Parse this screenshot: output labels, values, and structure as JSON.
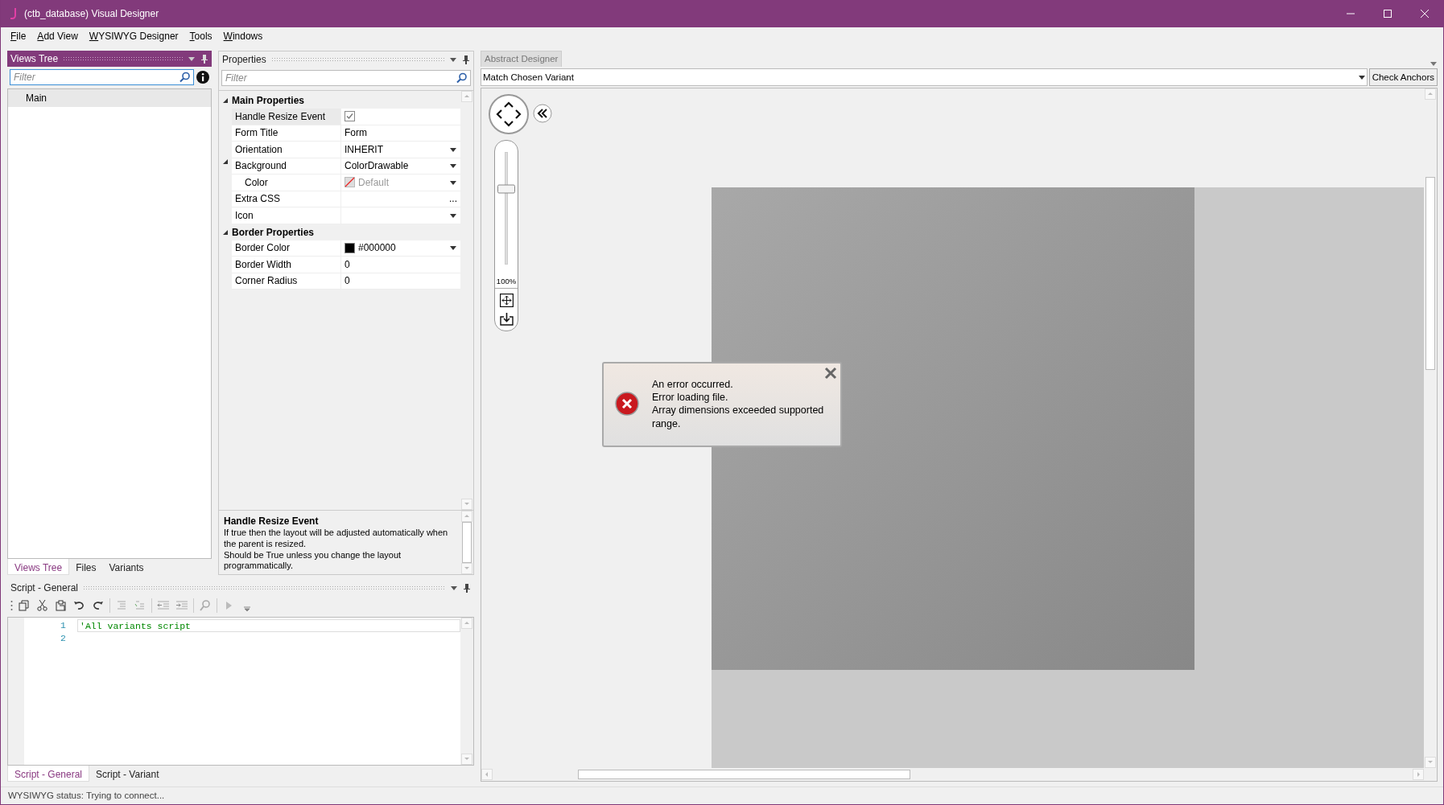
{
  "window": {
    "title": "(ctb_database) Visual Designer"
  },
  "menu": [
    {
      "label": "File"
    },
    {
      "label": "Add View"
    },
    {
      "label": "WYSIWYG Designer"
    },
    {
      "label": "Tools"
    },
    {
      "label": "Windows"
    }
  ],
  "views_tree": {
    "title": "Views Tree",
    "active": true,
    "filter": {
      "placeholder": "Filter"
    },
    "items": [
      {
        "label": "Main",
        "selected": true
      }
    ],
    "tabs": [
      {
        "label": "Views Tree",
        "selected": true
      },
      {
        "label": "Files",
        "selected": false
      },
      {
        "label": "Variants",
        "selected": false
      }
    ]
  },
  "properties": {
    "title": "Properties",
    "active": false,
    "filter": {
      "placeholder": "Filter"
    },
    "groups": [
      {
        "label": "Main Properties",
        "expanded": true,
        "rows": [
          {
            "name": "Handle Resize Event",
            "kind": "checkbox",
            "checked": true,
            "selected": true
          },
          {
            "name": "Form Title",
            "kind": "text",
            "value": "Form",
            "selected": false
          },
          {
            "name": "Orientation",
            "kind": "dropdown",
            "value": "INHERIT",
            "selected": false
          },
          {
            "name": "Background",
            "kind": "dropdown",
            "value": "ColorDrawable",
            "selected": false,
            "expanded": true,
            "children": [
              {
                "name": "Color",
                "kind": "color-none",
                "value": "Default",
                "selected": false
              }
            ]
          },
          {
            "name": "Extra CSS",
            "kind": "ellipsis",
            "value_button": "...",
            "selected": false
          },
          {
            "name": "Icon",
            "kind": "dropdown",
            "selected": false
          }
        ]
      },
      {
        "label": "Border Properties",
        "expanded": true,
        "rows": [
          {
            "name": "Border Color",
            "kind": "color",
            "value": "#000000",
            "selected": false
          },
          {
            "name": "Border Width",
            "kind": "text",
            "value": "0",
            "selected": false
          },
          {
            "name": "Corner Radius",
            "kind": "text",
            "value": "0",
            "selected": false
          }
        ]
      }
    ],
    "description": {
      "title": "Handle Resize Event",
      "lines": [
        "If true then the layout will be adjusted automatically when the parent is resized.",
        "Should be True unless you change the layout programmatically."
      ]
    }
  },
  "script": {
    "title": "Script - General",
    "active": false,
    "lines": [
      {
        "number": "1",
        "code": "'All variants script"
      },
      {
        "number": "2"
      }
    ],
    "tabs": [
      {
        "label": "Script - General",
        "selected": true
      },
      {
        "label": "Script - Variant",
        "selected": false
      }
    ]
  },
  "designer": {
    "tab": "Abstract Designer",
    "variant_select": "Match Chosen Variant",
    "check_anchors": "Check Anchors",
    "zoom": {
      "level": 0.66,
      "label": "100%"
    },
    "error": {
      "lines": [
        "An error occurred.",
        "Error loading file.",
        "Array dimensions exceeded supported range."
      ]
    }
  },
  "status_bar": {
    "text": "WYSIWYG status: Trying to connect..."
  }
}
